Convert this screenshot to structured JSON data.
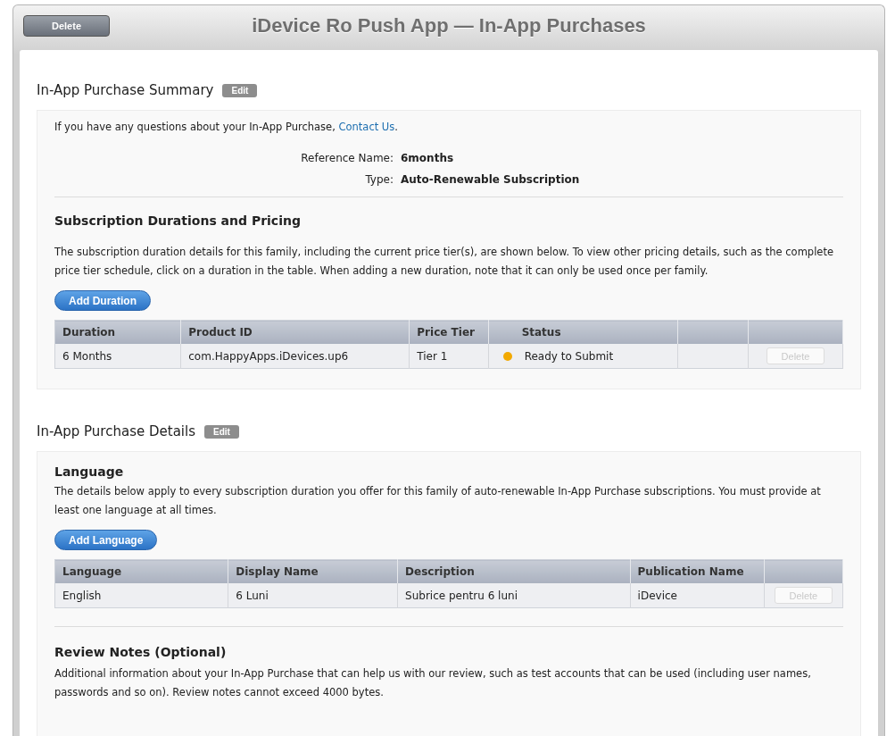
{
  "header": {
    "delete_button": "Delete",
    "title": "iDevice Ro Push App — In-App Purchases"
  },
  "summary": {
    "heading": "In-App Purchase Summary",
    "edit_button": "Edit",
    "contact_text": "If you have any questions about your In-App Purchase,",
    "contact_link": "Contact Us",
    "contact_end": ".",
    "fields": [
      {
        "label": "Reference Name:",
        "value": "6months"
      },
      {
        "label": "Type:",
        "value": "Auto-Renewable Subscription"
      }
    ],
    "pricing": {
      "heading": "Subscription Durations and Pricing",
      "description": "The subscription duration details for this family, including the current price tier(s), are shown below. To view other pricing details, such as the complete price tier schedule, click on a duration in the table. When adding a new duration, note that it can only be used once per family.",
      "add_button": "Add Duration",
      "columns": [
        "Duration",
        "Product ID",
        "Price Tier",
        "Status"
      ],
      "rows": [
        {
          "duration": "6 Months",
          "product_id": "com.HappyApps.iDevices.up6",
          "price_tier": "Tier 1",
          "status": "Ready to Submit",
          "color": "#f2a900",
          "delete_button": "Delete",
          "disabled": true
        }
      ]
    }
  },
  "details": {
    "heading": "In-App Purchase Details",
    "edit_button": "Edit",
    "language": {
      "heading": "Language",
      "description": "The details below apply to every subscription duration you offer for this family of auto-renewable In-App Purchase subscriptions. You must provide at least one language at all times.",
      "add_button": "Add Language",
      "columns": [
        "Language",
        "Display Name",
        "Description",
        "Publication Name"
      ],
      "rows": [
        {
          "language": "English",
          "display_name": "6 Luni",
          "description": "Subrice pentru 6 luni",
          "publication_name": "iDevice",
          "delete_button": "Delete",
          "disabled": true
        }
      ]
    },
    "review": {
      "heading": "Review Notes (Optional)",
      "description": "Additional information about your In-App Purchase that can help us with our review, such as test accounts that can be used (including user names, passwords and so on). Review notes cannot exceed 4000 bytes."
    }
  }
}
